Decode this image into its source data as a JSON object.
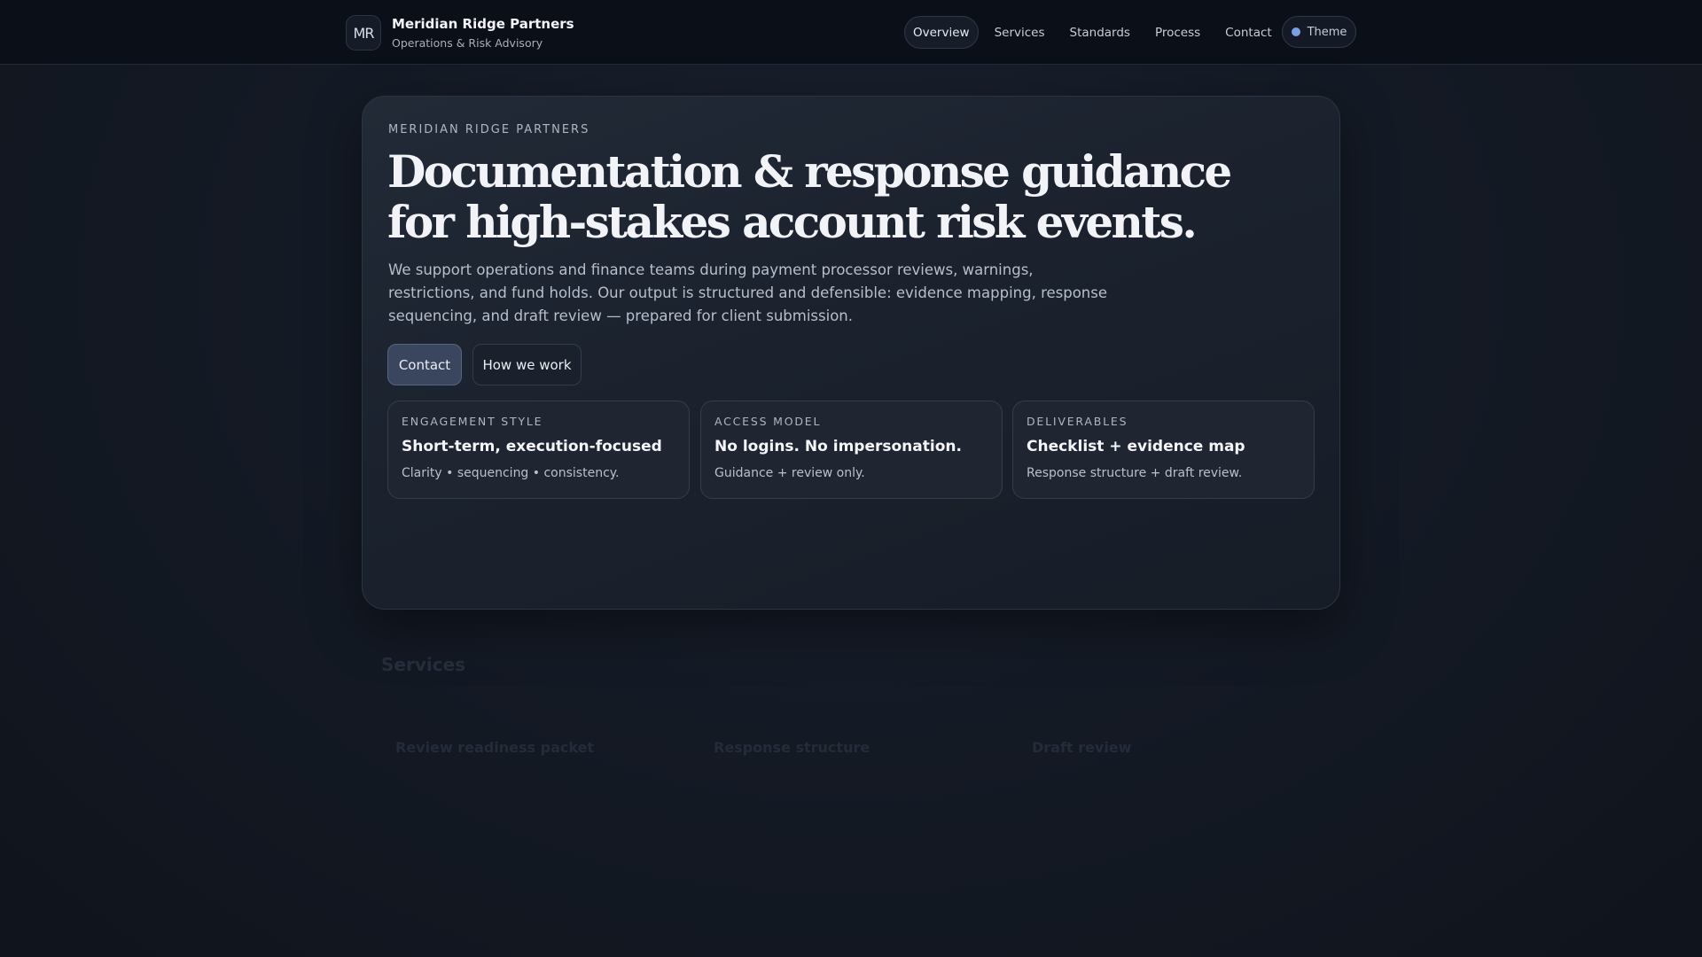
{
  "header": {
    "logo_text": "MR",
    "brand_name": "Meridian Ridge Partners",
    "brand_subtitle": "Operations & Risk Advisory",
    "nav": [
      "Overview",
      "Services",
      "Standards",
      "Process",
      "Contact"
    ],
    "active_nav": "Overview",
    "theme_label": "Theme",
    "theme_dot_color": "#7c9ee6"
  },
  "hero": {
    "eyebrow": "MERIDIAN RIDGE PARTNERS",
    "headline": "Documentation & response guidance for high-stakes account risk events.",
    "intro": "We support operations and finance teams during payment processor reviews, warnings, restrictions, and fund holds. Our output is structured and defensible: evidence mapping, response sequencing, and draft review — prepared for client submission.",
    "primary_button": "Contact",
    "secondary_button": "How we work",
    "features": [
      {
        "label": "ENGAGEMENT STYLE",
        "title": "Short-term, execution-focused",
        "desc": "Clarity • sequencing • consistency."
      },
      {
        "label": "ACCESS MODEL",
        "title": "No logins. No impersonation.",
        "desc": "Guidance + review only."
      },
      {
        "label": "DELIVERABLES",
        "title": "Checklist + evidence map",
        "desc": "Response structure + draft review."
      }
    ]
  },
  "services": {
    "title": "Services",
    "items": [
      {
        "title": "Review readiness packet"
      },
      {
        "title": "Response structure"
      },
      {
        "title": "Draft review"
      }
    ]
  }
}
